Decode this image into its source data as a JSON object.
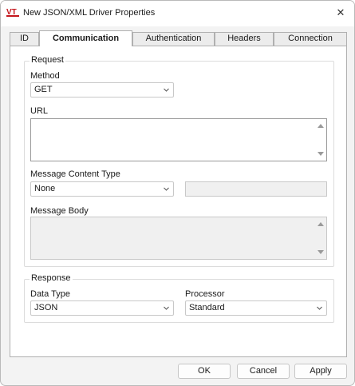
{
  "window": {
    "title": "New JSON/XML Driver Properties",
    "app_icon_text": "VT",
    "close_glyph": "✕"
  },
  "tabs": [
    {
      "label": "ID",
      "active": false
    },
    {
      "label": "Communication",
      "active": true
    },
    {
      "label": "Authentication",
      "active": false
    },
    {
      "label": "Headers",
      "active": false
    },
    {
      "label": "Connection",
      "active": false
    }
  ],
  "request": {
    "group_label": "Request",
    "method_label": "Method",
    "method_value": "GET",
    "url_label": "URL",
    "url_value": "",
    "content_type_label": "Message Content Type",
    "content_type_value": "None",
    "content_type_extra": "",
    "body_label": "Message Body",
    "body_value": ""
  },
  "response": {
    "group_label": "Response",
    "data_type_label": "Data Type",
    "data_type_value": "JSON",
    "processor_label": "Processor",
    "processor_value": "Standard"
  },
  "buttons": {
    "ok": "OK",
    "cancel": "Cancel",
    "apply": "Apply"
  },
  "icons": {
    "app": "vt-logo-icon",
    "close": "close-icon",
    "dropdown": "chevron-down-icon",
    "scroll_up": "scroll-up-arrow-icon",
    "scroll_down": "scroll-down-arrow-icon"
  }
}
